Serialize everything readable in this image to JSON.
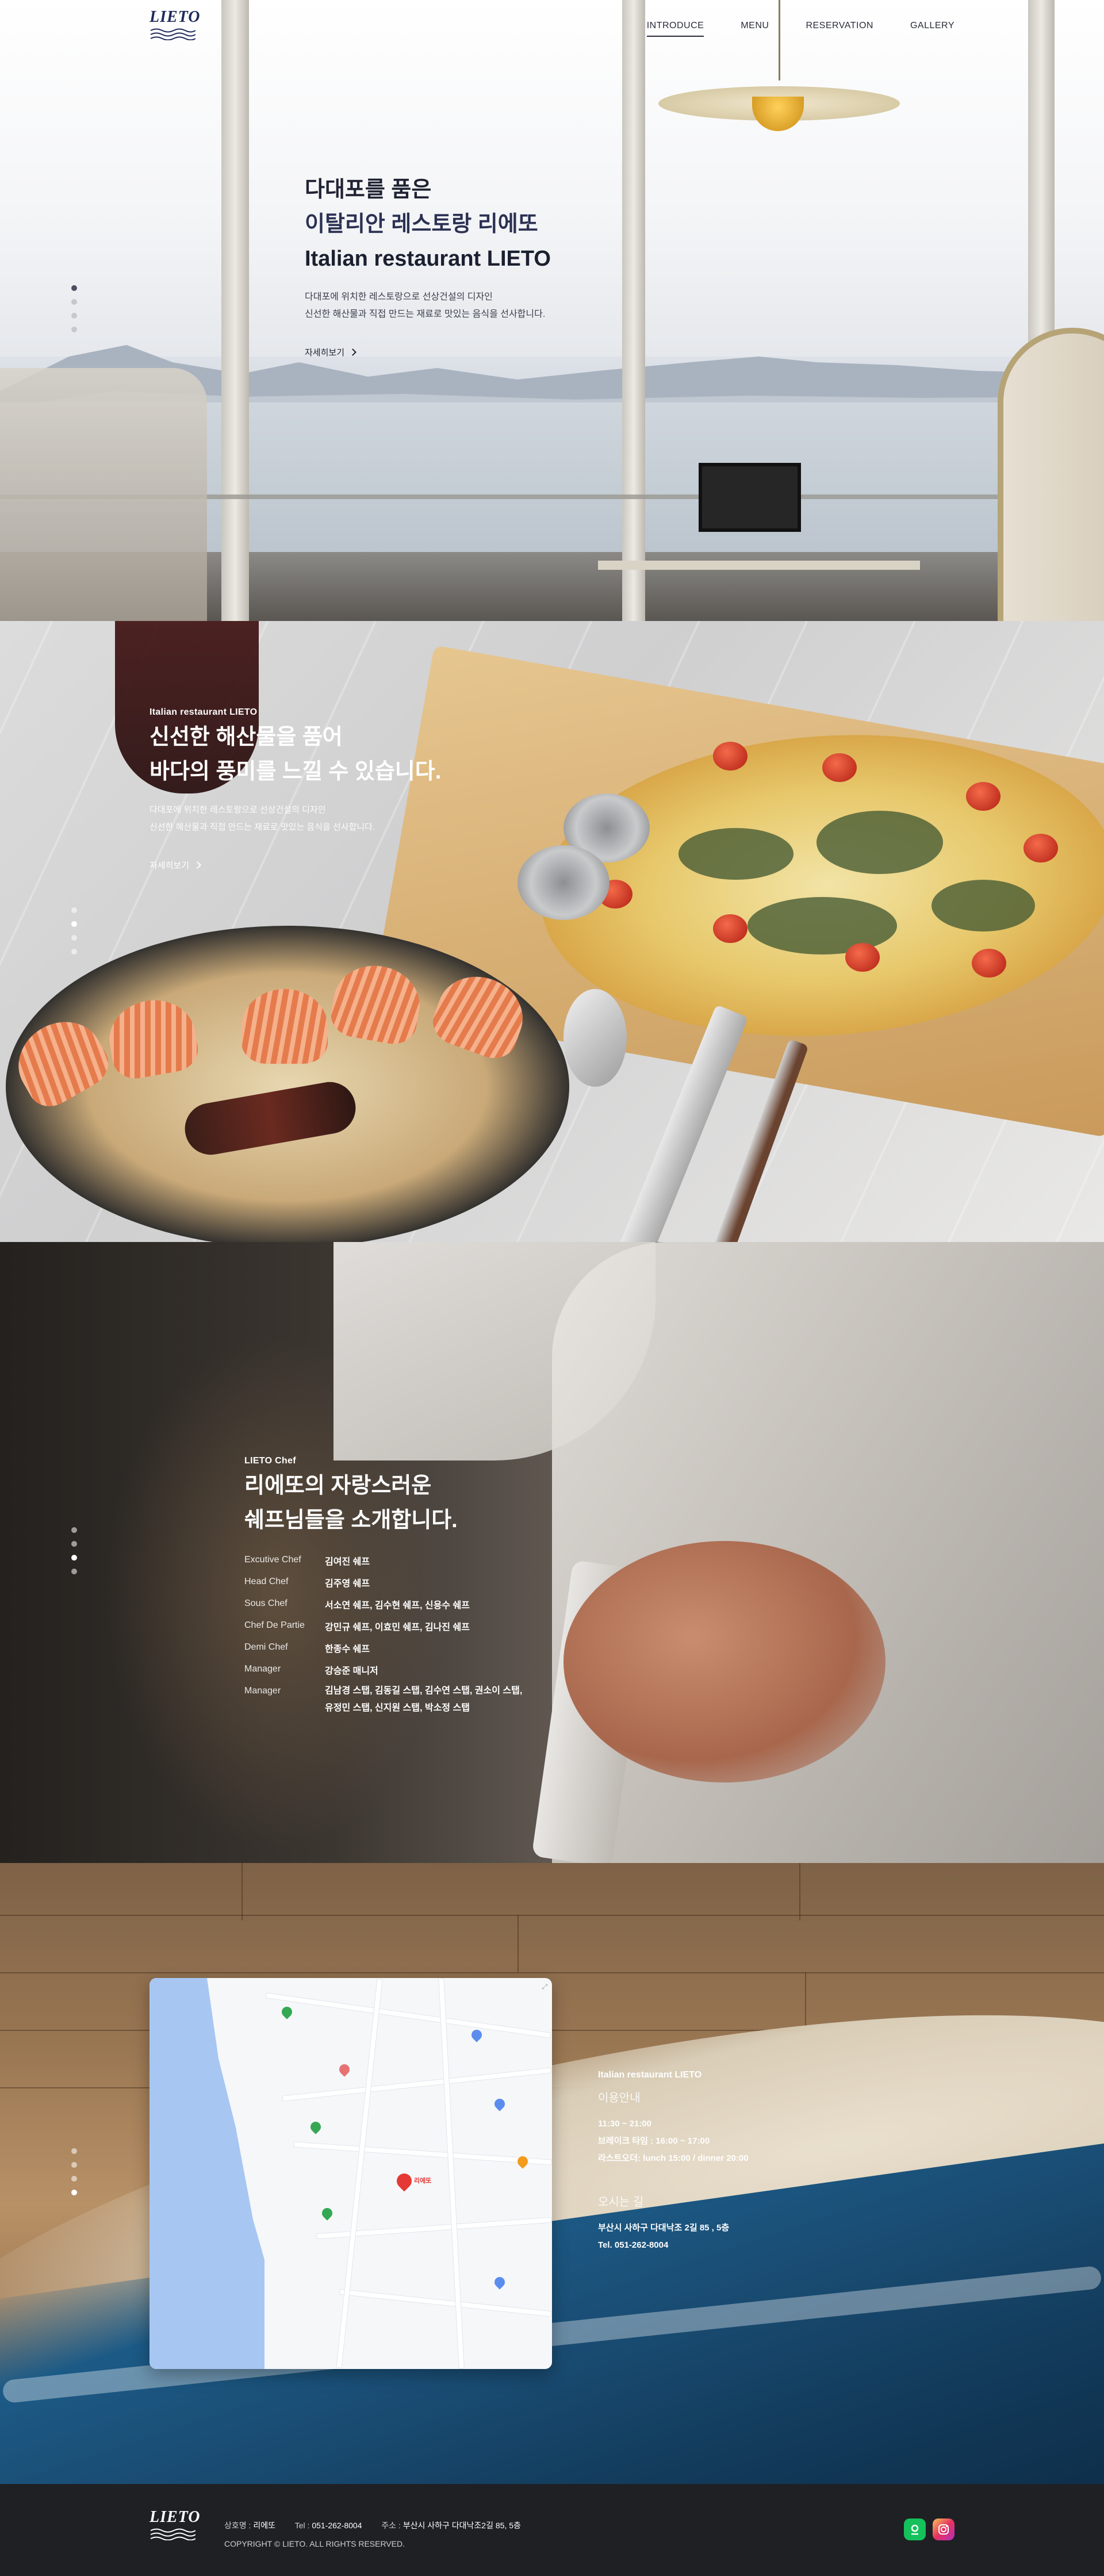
{
  "header": {
    "logo_text": "LIETO",
    "nav": [
      {
        "label": "INTRODUCE",
        "active": true
      },
      {
        "label": "MENU",
        "active": false
      },
      {
        "label": "RESERVATION",
        "active": false
      },
      {
        "label": "GALLERY",
        "active": false
      }
    ]
  },
  "hero": {
    "title_line1": "다대포를 품은",
    "title_line2": "이탈리안 레스토랑 리에또",
    "title_line3": "Italian restaurant LIETO",
    "desc_line1": "다대포에 위치한 레스토랑으로 선상건설의 디자인",
    "desc_line2": "신선한 해산물과 직접 만드는 재료로 맛있는 음식을 선사합니다.",
    "more_label": "자세히보기"
  },
  "food": {
    "kicker": "Italian restaurant LIETO",
    "title_line1": "신선한 해산물을 품어",
    "title_line2": "바다의 풍미를 느낄 수 있습니다.",
    "desc_line1": "다대포에 위치한 레스토랑으로 선상건설의 디자인",
    "desc_line2": "신선한 해산물과 직접 만드는 재료로 맛있는 음식을 선사합니다.",
    "more_label": "자세히보기"
  },
  "chef": {
    "kicker": "LIETO Chef",
    "title_line1": "리에또의 자랑스러운",
    "title_line2": "쉐프님들을 소개합니다.",
    "staff": [
      {
        "role": "Excutive Chef",
        "names": [
          "김여진 쉐프"
        ]
      },
      {
        "role": "Head Chef",
        "names": [
          "김주영 쉐프"
        ]
      },
      {
        "role": "Sous Chef",
        "names": [
          "서소연 쉐프, 김수현 쉐프, 신용수 쉐프"
        ]
      },
      {
        "role": "Chef De Partie",
        "names": [
          "강민규 쉐프, 이효민 쉐프, 김나진 쉐프"
        ]
      },
      {
        "role": "Demi Chef",
        "names": [
          "한종수 쉐프"
        ]
      },
      {
        "role": "Manager",
        "names": [
          "강승준 매니저"
        ]
      },
      {
        "role": "Manager",
        "names": [
          "김남경 스탭, 김동길 스탭, 김수연 스탭, 권소이 스탭,",
          "유정민 스탭, 신지원 스탭, 박소정 스탭"
        ]
      }
    ]
  },
  "location": {
    "kicker": "Italian restaurant LIETO",
    "hours_title": "이용안내",
    "hours": [
      "11:30 ~ 21:00",
      "브레이크 타임 : 16:00 ~ 17:00",
      "라스트오더: lunch 15:00 / dinner 20:00"
    ],
    "directions_title": "오시는 길",
    "address": "부산시 사하구 다대낙조 2길 85 , 5층",
    "tel": "Tel. 051-262-8004",
    "map_pin_label": "리에또"
  },
  "footer": {
    "logo_text": "LIETO",
    "company_label": "상호명 :",
    "company_value": "리에또",
    "tel_label": "Tel :",
    "tel_value": "051-262-8004",
    "addr_label": "주소 :",
    "addr_value": "부산시 사하구 다대낙조2길 85, 5층",
    "copyright": "COPYRIGHT © LIETO. ALL RIGHTS RESERVED."
  },
  "icons": {
    "sns": [
      "naver-map-icon",
      "instagram-icon"
    ]
  },
  "colors": {
    "dark_text": "#1f2332",
    "footer_bg": "#1f2024",
    "naver": "#14c15a"
  }
}
